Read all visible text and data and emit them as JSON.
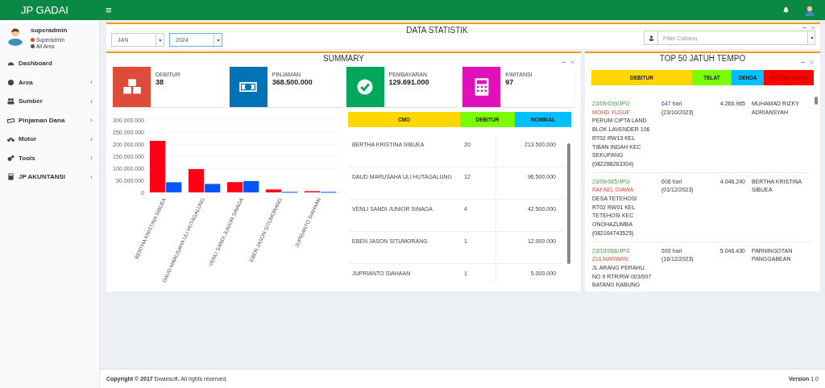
{
  "header": {
    "logo": "JP GADAI",
    "menu_icon": "≡"
  },
  "user": {
    "name": "superadmin",
    "role": "Superadmin",
    "area": "All Area"
  },
  "sidebar": {
    "items": [
      {
        "label": "Dashboard",
        "kind": "dashboard"
      },
      {
        "label": "Area",
        "kind": "globe",
        "chevron": "‹"
      },
      {
        "label": "Sumber",
        "kind": "users",
        "chevron": "‹"
      },
      {
        "label": "Pinjaman Dana",
        "kind": "hand",
        "chevron": "‹"
      },
      {
        "label": "Motor",
        "kind": "motor",
        "chevron": "‹"
      },
      {
        "label": "Tools",
        "kind": "gears",
        "chevron": "‹"
      },
      {
        "label": "JP AKUNTANSI",
        "kind": "calc",
        "chevron": "‹"
      }
    ]
  },
  "statistics": {
    "title": "DATA STATISTIK",
    "month": "JAN",
    "year": "2024",
    "branch_placeholder": "Filter Cabang"
  },
  "summary": {
    "title": "SUMMARY",
    "cards": [
      {
        "kind": "boxes",
        "label": "DEBITUR",
        "value": "38",
        "color": "#dd4b39"
      },
      {
        "kind": "money",
        "label": "PINJAMAN",
        "value": "368.500.000",
        "color": "#0073b7"
      },
      {
        "kind": "check",
        "label": "PEMBAYARAN",
        "value": "129.691.000",
        "color": "#00a65a"
      },
      {
        "kind": "calc",
        "label": "KWITANSI",
        "value": "97",
        "color": "#e011b8"
      }
    ],
    "chart_data": {
      "type": "bar",
      "categories": [
        "BERTHA KRISTINA SIBUEA",
        "DAUD MARUSAHA ULI HUTAGALUNG",
        "VENLI SANDI JUNIOR SINAGA",
        "EBEN JASON SITUMORANG",
        "JUPRIANTO SIAHAAN"
      ],
      "series": [
        {
          "color": "#ff0015",
          "values": [
            213500000,
            96500000,
            42500000,
            12000000,
            5000000
          ]
        },
        {
          "color": "#0055ff",
          "values": [
            42000000,
            35000000,
            47000000,
            2000000,
            2000000
          ]
        }
      ],
      "ylim": [
        0,
        300000000
      ],
      "yticks": [
        {
          "value": 0,
          "label": "0"
        },
        {
          "value": 50000000,
          "label": "50.000.000"
        },
        {
          "value": 100000000,
          "label": "100.000.000"
        },
        {
          "value": 150000000,
          "label": "150.000.000"
        },
        {
          "value": 200000000,
          "label": "200.000.000"
        },
        {
          "value": 250000000,
          "label": "250.000.000"
        },
        {
          "value": 300000000,
          "label": "300.000.000"
        }
      ]
    },
    "table": {
      "columns": [
        "CMO",
        "DEBITUR",
        "NOMINAL"
      ],
      "rows": [
        {
          "cmo": "BERTHA KRISTINA SIBUEA",
          "debitur": "20",
          "nominal": "213.500.000"
        },
        {
          "cmo": "DAUD MARUSAHA ULI HUTAGALUNG",
          "debitur": "12",
          "nominal": "96.500.000"
        },
        {
          "cmo": "VENLI SANDI JUNIOR SINAGA",
          "debitur": "4",
          "nominal": "42.500.000"
        },
        {
          "cmo": "EBEN JASON SITUMORANG",
          "debitur": "1",
          "nominal": "12.000.000"
        },
        {
          "cmo": "JUPRIANTO SIAHAAN",
          "debitur": "1",
          "nominal": "5.000.000"
        }
      ]
    }
  },
  "due": {
    "title": "TOP 50 JATUH TEMPO",
    "columns": [
      "DEBITUR",
      "TELAT",
      "DENDA",
      "KETERANGAN"
    ],
    "rows": [
      {
        "code": "23/09/039/JPG",
        "name": "MOHD YUSUF",
        "address": [
          "PERUM CIPTA LAND",
          "BLOK LAVENDER 106",
          "RT02 RW13 KEL",
          "TIBAN INDAH KEC",
          "SEKUPANG",
          "(082288263304)"
        ],
        "late": "647 hari",
        "date": "(23/10/2023)",
        "fine": "4.266.965",
        "note": "MUHAMAD RIZKY ADRIANSYAH"
      },
      {
        "code": "23/09/065/JPG",
        "name": "RAFAEL GIAWA",
        "address": [
          "DESA TETEHOSI",
          "RT02 RW01 KEL",
          "TETEHOSI KEC",
          "ONOHAZUMBA",
          "(082164743525)"
        ],
        "late": "608 hari",
        "date": "(01/12/2023)",
        "fine": "4.046.240",
        "note": "BERTHA KRISTINA SIBUEA"
      },
      {
        "code": "23/10/068/JPG",
        "name": "ZULMARWAN",
        "address": [
          "JL ARANG PERAHU",
          "NO 9 RTR/RW 003/007",
          "BATANG KABUNG"
        ],
        "late": "593 hari",
        "date": "(16/12/2023)",
        "fine": "5.046.430",
        "note": "PARNINGOTAN PANGGABEAN"
      }
    ]
  },
  "footer": {
    "copyright": "**Copyright © 2017** Dwansoft**.** All rights reserved.",
    "version": "**Version** 1.0"
  }
}
